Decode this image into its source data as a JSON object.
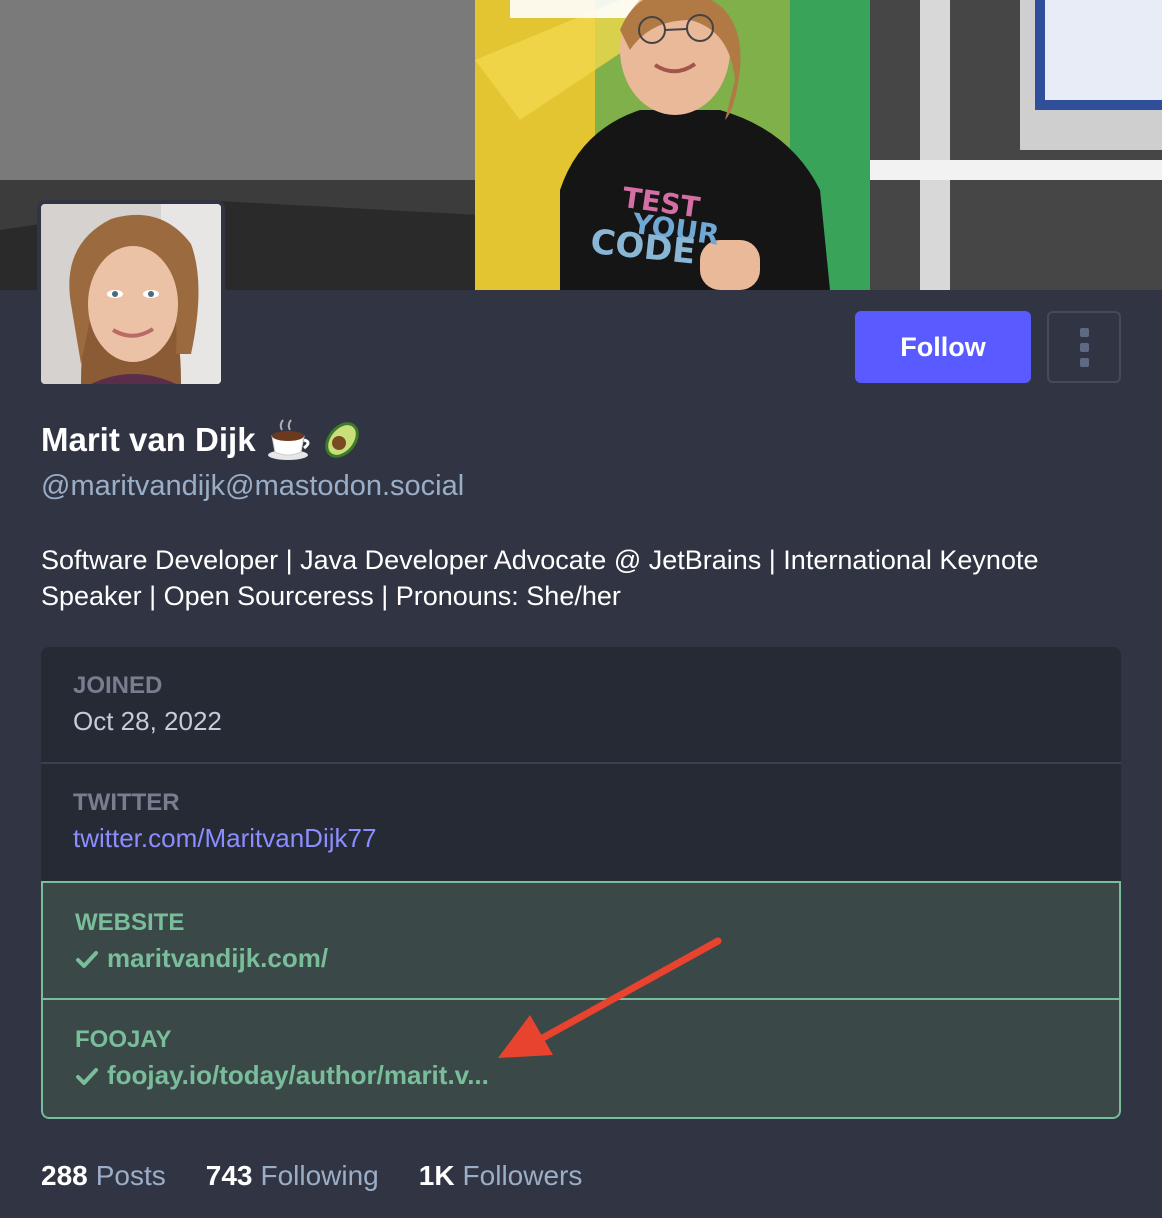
{
  "profile": {
    "display_name": "Marit van Dijk",
    "name_emojis": [
      "hot-beverage",
      "avocado"
    ],
    "handle": "@maritvandijk@mastodon.social",
    "bio": "Software Developer | Java Developer Advocate @ JetBrains | International Keynote Speaker | Open Sourceress | Pronouns: She/her",
    "banner_shirt_text": [
      "TEST",
      "YOUR",
      "CODE"
    ]
  },
  "actions": {
    "follow_label": "Follow",
    "menu_icon": "kebab-menu-icon"
  },
  "fields": [
    {
      "label": "JOINED",
      "value": "Oct 28, 2022",
      "verified": false
    },
    {
      "label": "TWITTER",
      "value": "twitter.com/MaritvanDijk77",
      "verified": false
    },
    {
      "label": "WEBSITE",
      "value": "maritvandijk.com/",
      "verified": true
    },
    {
      "label": "FOOJAY",
      "value": "foojay.io/today/author/marit.v...",
      "verified": true
    }
  ],
  "stats": {
    "posts_count": "288",
    "posts_label": "Posts",
    "following_count": "743",
    "following_label": "Following",
    "followers_count": "1K",
    "followers_label": "Followers"
  },
  "colors": {
    "background": "#313543",
    "accent": "#595aff",
    "verified": "#79bd9a",
    "annotation_arrow": "#e8432e"
  }
}
